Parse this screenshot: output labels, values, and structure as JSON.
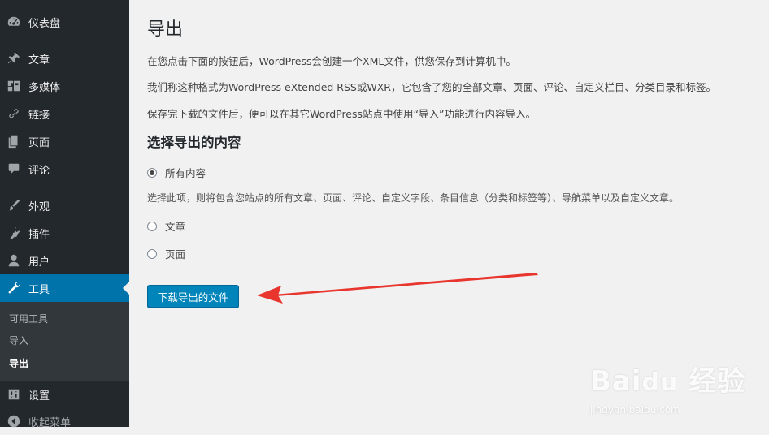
{
  "sidebar": {
    "items": [
      {
        "label": "仪表盘",
        "icon": "dashboard-icon"
      },
      {
        "label": "文章",
        "icon": "pin-icon"
      },
      {
        "label": "多媒体",
        "icon": "media-icon"
      },
      {
        "label": "链接",
        "icon": "link-icon"
      },
      {
        "label": "页面",
        "icon": "pages-icon"
      },
      {
        "label": "评论",
        "icon": "comment-icon"
      },
      {
        "label": "外观",
        "icon": "brush-icon"
      },
      {
        "label": "插件",
        "icon": "plugin-icon"
      },
      {
        "label": "用户",
        "icon": "user-icon"
      },
      {
        "label": "工具",
        "icon": "wrench-icon"
      },
      {
        "label": "设置",
        "icon": "settings-icon"
      },
      {
        "label": "收起菜单",
        "icon": "collapse-icon"
      }
    ],
    "active_item": "工具",
    "submenu": [
      {
        "label": "可用工具"
      },
      {
        "label": "导入"
      },
      {
        "label": "导出"
      }
    ],
    "current_submenu": "导出"
  },
  "main": {
    "title": "导出",
    "paragraphs": [
      "在您点击下面的按钮后，WordPress会创建一个XML文件，供您保存到计算机中。",
      "我们称这种格式为WordPress eXtended RSS或WXR，它包含了您的全部文章、页面、评论、自定义栏目、分类目录和标签。",
      "保存完下载的文件后，便可以在其它WordPress站点中使用“导入”功能进行内容导入。"
    ],
    "section_title": "选择导出的内容",
    "options": [
      {
        "label": "所有内容",
        "checked": true
      },
      {
        "label": "文章",
        "checked": false
      },
      {
        "label": "页面",
        "checked": false
      }
    ],
    "all_content_note": "选择此项，则将包含您站点的所有文章、页面、评论、自定义字段、条目信息（分类和标签等）、导航菜单以及自定义文章。",
    "download_button": "下载导出的文件"
  },
  "watermark": {
    "brand": "Bai",
    "brand_suffix": "经验",
    "url": "jingyan.baidu.com"
  },
  "colors": {
    "sidebar_bg": "#23282d",
    "submenu_bg": "#32373c",
    "active_bg": "#0073aa",
    "button_bg": "#0085ba",
    "annotation_arrow": "#e8352e",
    "page_bg": "#f1f1f1"
  }
}
